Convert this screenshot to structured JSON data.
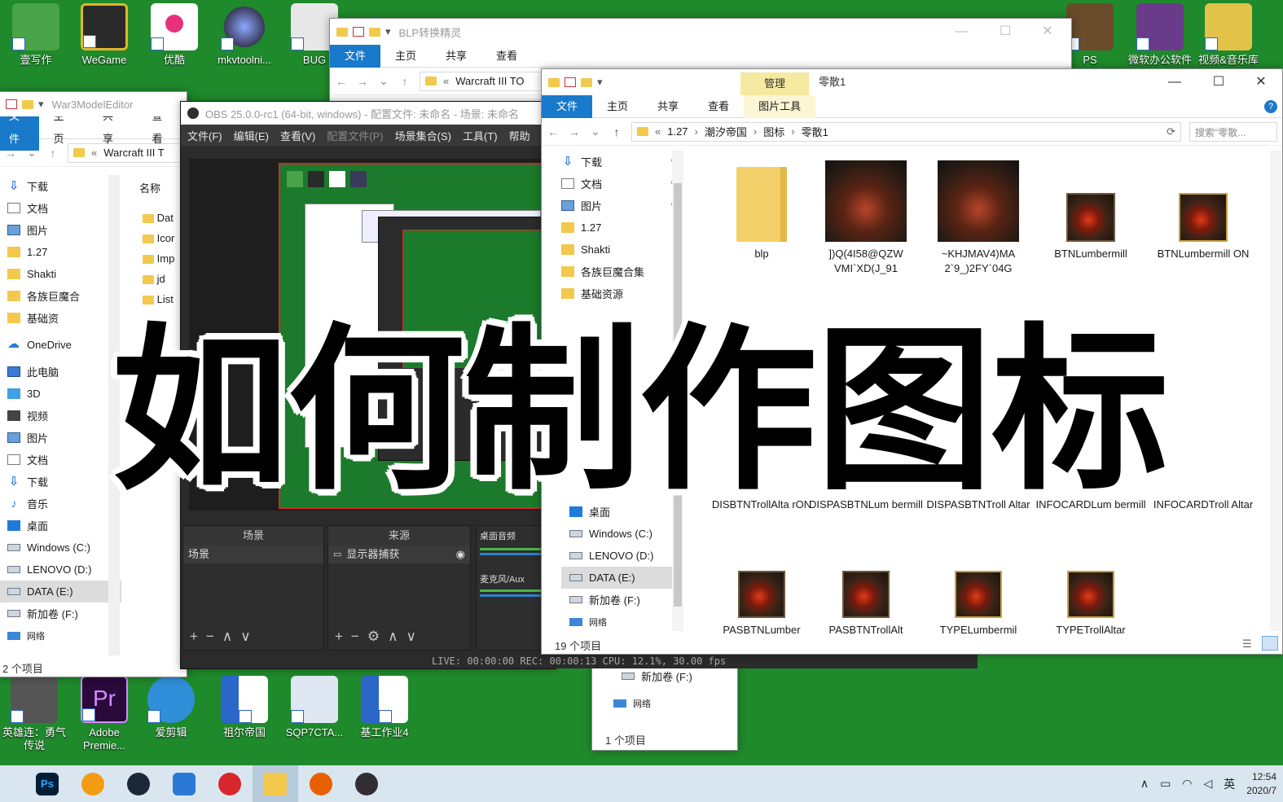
{
  "overlay_title": "如何制作图标",
  "desktop": {
    "top_icons": [
      {
        "label": "壹写作",
        "color": "#49a348"
      },
      {
        "label": "WeGame",
        "color": "#2a2a2a"
      },
      {
        "label": "优酷",
        "color": "#ffffff"
      },
      {
        "label": "mkvtoolni...",
        "color": "#3a3a5a"
      },
      {
        "label": "BUG",
        "color": "#e8e8e8"
      }
    ],
    "right_icons": [
      {
        "label": "PS",
        "color": "#6a4b2a"
      },
      {
        "label": "微软办公软件",
        "color": "#6a3b8a"
      },
      {
        "label": "视频&音乐库",
        "color": "#e3c24a"
      }
    ],
    "bottom_icons": [
      {
        "label": "英雄连：勇气传说",
        "color": "#555555"
      },
      {
        "label": "Adobe Premie...",
        "color": "#2a0a3a"
      },
      {
        "label": "爱剪辑",
        "color": "#2f8fd8"
      },
      {
        "label": "祖尔帝国",
        "color": "#2b66c9"
      },
      {
        "label": "SQP7CTA...",
        "color": "#dfe8f2"
      },
      {
        "label": "基工作业4",
        "color": "#2b66c9"
      }
    ]
  },
  "blp_window": {
    "title": "BLP转换精灵",
    "tabs": [
      "文件",
      "主页",
      "共享",
      "查看"
    ],
    "address": "Warcraft III TO"
  },
  "left_explorer": {
    "title": "War3ModelEditor",
    "tabs": [
      "文件",
      "主页",
      "共享",
      "查看"
    ],
    "address": "Warcraft III T",
    "column_header": "名称",
    "files": [
      "Dat",
      "Icor",
      "Imp",
      "jd",
      "List"
    ],
    "nav": [
      "下载",
      "文档",
      "图片",
      "1.27",
      "Shakti",
      "各族巨魔合",
      "基础资",
      "OneDrive",
      "此电脑",
      "3D",
      "视频",
      "图片",
      "文档",
      "下载",
      "音乐",
      "桌面",
      "Windows (C:)",
      "LENOVO (D:)",
      "DATA (E:)",
      "新加卷 (F:)",
      "网络"
    ],
    "status": "2 个项目"
  },
  "obs": {
    "title": "OBS 25.0.0-rc1 (64-bit, windows) - 配置文件: 未命名 - 场景: 未命名",
    "menu": [
      "文件(F)",
      "编辑(E)",
      "查看(V)",
      "配置文件(P)",
      "场景集合(S)",
      "工具(T)",
      "帮助"
    ],
    "scenes_header": "场景",
    "scene_item": "场景",
    "sources_header": "来源",
    "source_item": "显示器捕获",
    "mixer_header": "桌面音频",
    "mixer_item": "麦克风/Aux",
    "status_line": "LIVE: 00:00:00   REC: 00:00:13   CPU: 12.1%, 30.00 fps"
  },
  "main_explorer": {
    "manage_tab": "管理",
    "title": "零散1",
    "tabs": [
      "文件",
      "主页",
      "共享",
      "查看"
    ],
    "tool_tab": "图片工具",
    "breadcrumb": [
      "1.27",
      "潮汐帝国",
      "图标",
      "零散1"
    ],
    "search_placeholder": "搜索\"零散...",
    "nav": [
      "下载",
      "文档",
      "图片",
      "1.27",
      "Shakti",
      "各族巨魔合集",
      "基础资源"
    ],
    "nav_bottom": [
      "桌面",
      "Windows (C:)",
      "LENOVO (D:)",
      "DATA (E:)",
      "新加卷 (F:)",
      "网络"
    ],
    "files": [
      {
        "name": "blp",
        "kind": "folder"
      },
      {
        "name": "])Q(4I58@QZW VMI`XD(J_91",
        "kind": "art"
      },
      {
        "name": "~KHJMAV4)MA 2`9_)2FY`04G",
        "kind": "art"
      },
      {
        "name": "BTNLumbermill",
        "kind": "icon"
      },
      {
        "name": "BTNLumbermill ON",
        "kind": "gold"
      },
      {
        "name": "DISBTNTrollAlta rON",
        "kind": "hidden"
      },
      {
        "name": "DISPASBTNLum bermill",
        "kind": "hidden"
      },
      {
        "name": "DISPASBTNTroll Altar",
        "kind": "hidden"
      },
      {
        "name": "INFOCARDLum bermill",
        "kind": "hidden"
      },
      {
        "name": "INFOCARDTroll Altar",
        "kind": "hidden"
      },
      {
        "name": "PASBTNLumber",
        "kind": "icon"
      },
      {
        "name": "PASBTNTrollAlt",
        "kind": "icon"
      },
      {
        "name": "TYPELumbermil",
        "kind": "gold"
      },
      {
        "name": "TYPETrollAltar",
        "kind": "gold"
      }
    ],
    "status": "19 个项目"
  },
  "back_explorer": {
    "nav": [
      "DATA (E:)",
      "新加卷 (F:)",
      "网络"
    ],
    "status": "1 个项目"
  },
  "taskbar": {
    "apps": [
      {
        "name": "Ps",
        "color": "#001e36"
      },
      {
        "name": "",
        "color": "#f39c12"
      },
      {
        "name": "",
        "color": "#1b2838"
      },
      {
        "name": "",
        "color": "#2b79d6"
      },
      {
        "name": "",
        "color": "#d8262d"
      },
      {
        "name": "",
        "color": "#f2c94c"
      },
      {
        "name": "",
        "color": "#e66000"
      },
      {
        "name": "",
        "color": "#302e31"
      }
    ],
    "ime": "英",
    "time": "12:54",
    "date": "2020/7"
  }
}
